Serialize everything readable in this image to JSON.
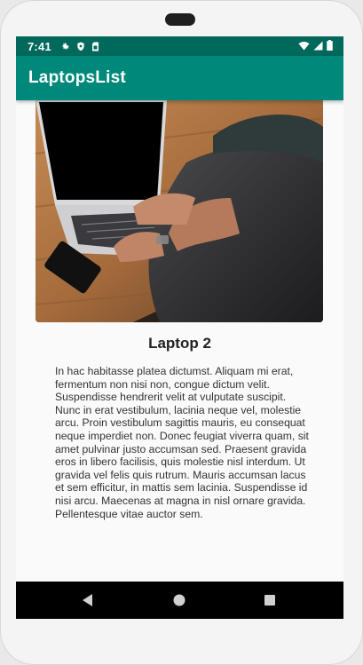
{
  "status_bar": {
    "time": "7:41",
    "left_icons": [
      "gear-icon",
      "shield-icon",
      "sim-card-icon"
    ],
    "right_icons": [
      "wifi-icon",
      "signal-icon",
      "battery-icon"
    ]
  },
  "app_bar": {
    "title": "LaptopsList",
    "color": "#00897b",
    "status_color": "#00695c"
  },
  "item": {
    "image": "laptop-photo",
    "title": "Laptop 2",
    "description": "In hac habitasse platea dictumst. Aliquam mi erat, fermentum non nisi non, congue dictum velit. Suspendisse hendrerit velit at vulputate suscipit. Nunc in erat vestibulum, lacinia neque vel, molestie arcu. Proin vestibulum sagittis mauris, eu consequat neque imperdiet non. Donec feugiat viverra quam, sit amet pulvinar justo accumsan sed. Praesent gravida eros in libero facilisis, quis molestie nisl interdum. Ut gravida vel felis quis rutrum. Mauris accumsan lacus et sem efficitur, in mattis sem lacinia. Suspendisse id nisi arcu. Maecenas at magna in nisl ornare gravida. Pellentesque vitae auctor sem."
  },
  "nav_bar": {
    "buttons": [
      "back-icon",
      "home-icon",
      "recents-icon"
    ]
  }
}
